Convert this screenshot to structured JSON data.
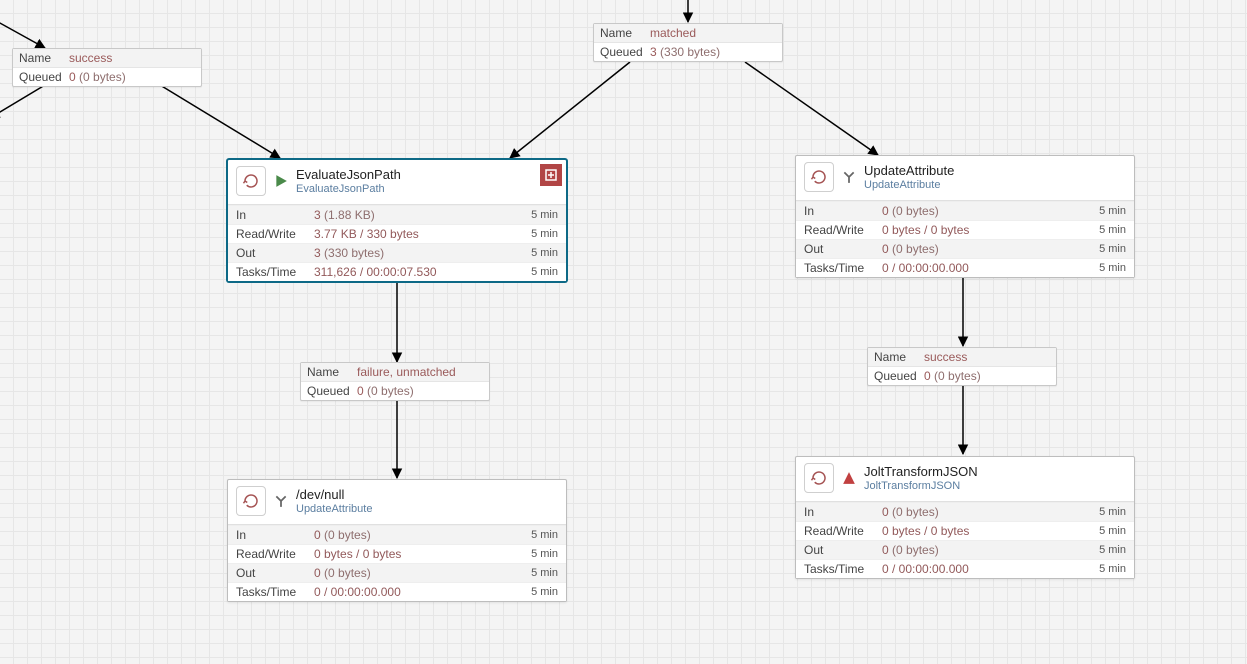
{
  "connections": {
    "success1": {
      "name_label": "Name",
      "name": "success",
      "queued_label": "Queued",
      "queued": "0",
      "queued_bytes": "(0 bytes)"
    },
    "matched": {
      "name_label": "Name",
      "name": "matched",
      "queued_label": "Queued",
      "queued": "3",
      "queued_bytes": "(330 bytes)"
    },
    "failure": {
      "name_label": "Name",
      "name": "failure, unmatched",
      "queued_label": "Queued",
      "queued": "0",
      "queued_bytes": "(0 bytes)"
    },
    "success2": {
      "name_label": "Name",
      "name": "success",
      "queued_label": "Queued",
      "queued": "0",
      "queued_bytes": "(0 bytes)"
    }
  },
  "processors": {
    "evaljson": {
      "title": "EvaluateJsonPath",
      "type": "EvaluateJsonPath",
      "status": "running",
      "stats": {
        "in_label": "In",
        "in": "3",
        "in_paren": "(1.88 KB)",
        "in_win": "5 min",
        "rw_label": "Read/Write",
        "rw": "3.77 KB / 330 bytes",
        "rw_win": "5 min",
        "out_label": "Out",
        "out": "3",
        "out_paren": "(330 bytes)",
        "out_win": "5 min",
        "tt_label": "Tasks/Time",
        "tt": "311,626 / 00:00:07.530",
        "tt_win": "5 min"
      }
    },
    "updateattr": {
      "title": "UpdateAttribute",
      "type": "UpdateAttribute",
      "status": "stopped",
      "stats": {
        "in_label": "In",
        "in": "0",
        "in_paren": "(0 bytes)",
        "in_win": "5 min",
        "rw_label": "Read/Write",
        "rw": "0 bytes / 0 bytes",
        "rw_win": "5 min",
        "out_label": "Out",
        "out": "0",
        "out_paren": "(0 bytes)",
        "out_win": "5 min",
        "tt_label": "Tasks/Time",
        "tt": "0 / 00:00:00.000",
        "tt_win": "5 min"
      }
    },
    "devnull": {
      "title": "/dev/null",
      "type": "UpdateAttribute",
      "status": "stopped",
      "stats": {
        "in_label": "In",
        "in": "0",
        "in_paren": "(0 bytes)",
        "in_win": "5 min",
        "rw_label": "Read/Write",
        "rw": "0 bytes / 0 bytes",
        "rw_win": "5 min",
        "out_label": "Out",
        "out": "0",
        "out_paren": "(0 bytes)",
        "out_win": "5 min",
        "tt_label": "Tasks/Time",
        "tt": "0 / 00:00:00.000",
        "tt_win": "5 min"
      }
    },
    "jolt": {
      "title": "JoltTransformJSON",
      "type": "JoltTransformJSON",
      "status": "invalid",
      "stats": {
        "in_label": "In",
        "in": "0",
        "in_paren": "(0 bytes)",
        "in_win": "5 min",
        "rw_label": "Read/Write",
        "rw": "0 bytes / 0 bytes",
        "rw_win": "5 min",
        "out_label": "Out",
        "out": "0",
        "out_paren": "(0 bytes)",
        "out_win": "5 min",
        "tt_label": "Tasks/Time",
        "tt": "0 / 00:00:00.000",
        "tt_win": "5 min"
      }
    }
  }
}
